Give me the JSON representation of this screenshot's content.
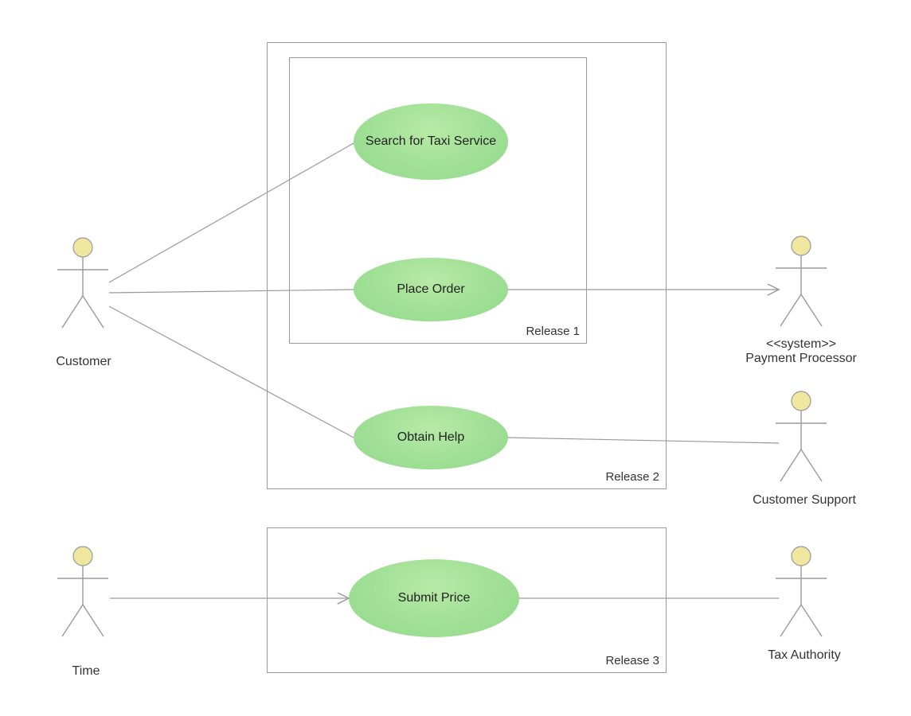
{
  "actors": {
    "customer": {
      "label": "Customer"
    },
    "payment_processor": {
      "stereotype": "<<system>>",
      "label": "Payment Processor"
    },
    "customer_support": {
      "label": "Customer Support"
    },
    "time": {
      "label": "Time"
    },
    "tax_authority": {
      "label": "Tax Authority"
    }
  },
  "releases": {
    "r1": {
      "label": "Release 1"
    },
    "r2": {
      "label": "Release 2"
    },
    "r3": {
      "label": "Release 3"
    }
  },
  "usecases": {
    "search": {
      "label": "Search for Taxi Service"
    },
    "place_order": {
      "label": "Place Order"
    },
    "obtain_help": {
      "label": "Obtain Help"
    },
    "submit_price": {
      "label": "Submit Price"
    }
  },
  "colors": {
    "line": "#9a9a9a",
    "head_fill": "#efe79d",
    "usecase_fill": "#a6e29a"
  }
}
